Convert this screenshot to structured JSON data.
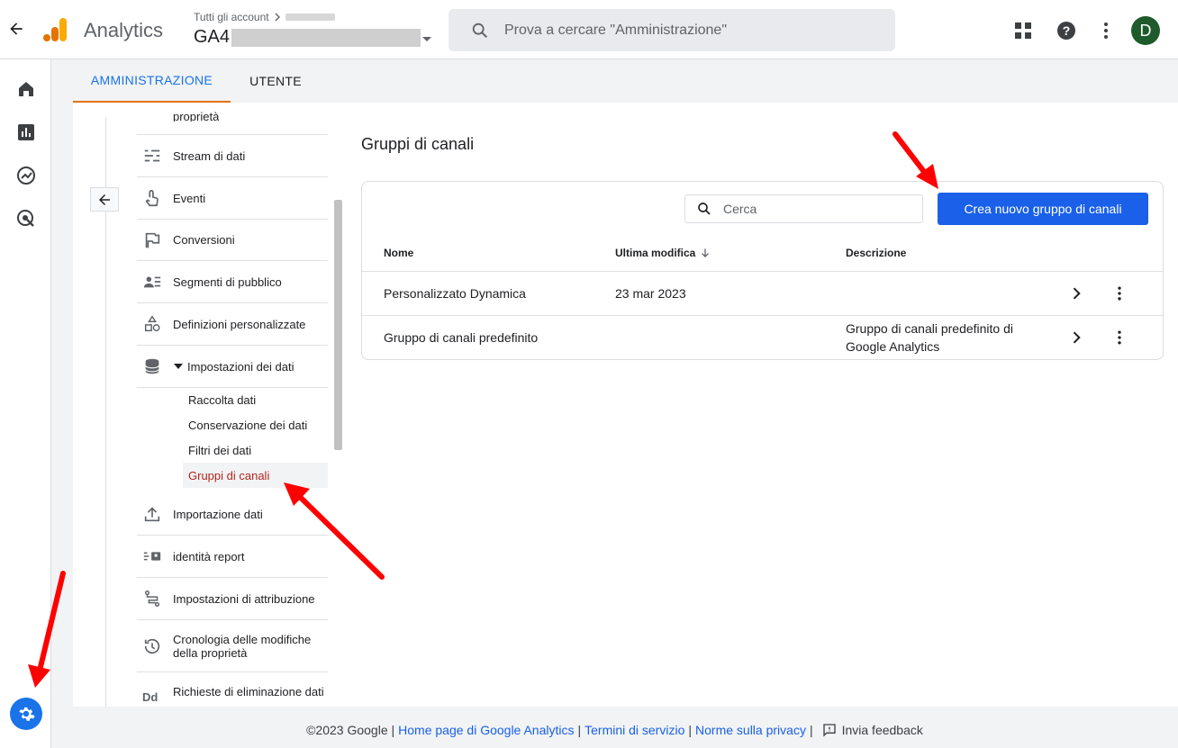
{
  "header": {
    "app_title": "Analytics",
    "breadcrumb": "Tutti gli account",
    "property_name": "GA4",
    "search_placeholder": "Prova a cercare \"Amministrazione\"",
    "avatar_initial": "D"
  },
  "tabs": [
    {
      "label": "AMMINISTRAZIONE",
      "active": true
    },
    {
      "label": "UTENTE",
      "active": false
    }
  ],
  "settings_nav": {
    "partial_label": "proprietà",
    "items": [
      {
        "label": "Stream di dati",
        "icon": "stream-icon"
      },
      {
        "label": "Eventi",
        "icon": "touch-icon"
      },
      {
        "label": "Conversioni",
        "icon": "flag-icon"
      },
      {
        "label": "Segmenti di pubblico",
        "icon": "audience-icon"
      },
      {
        "label": "Definizioni personalizzate",
        "icon": "shapes-icon"
      },
      {
        "label": "Impostazioni dei dati",
        "icon": "database-icon"
      }
    ],
    "sub_items": [
      {
        "label": "Raccolta dati"
      },
      {
        "label": "Conservazione dei dati"
      },
      {
        "label": "Filtri dei dati"
      },
      {
        "label": "Gruppi di canali",
        "active": true
      }
    ],
    "items_after": [
      {
        "label": "Importazione dati",
        "icon": "upload-icon"
      },
      {
        "label": "identità report",
        "icon": "identity-icon"
      },
      {
        "label": "Impostazioni di attribuzione",
        "icon": "attribution-icon"
      },
      {
        "label": "Cronologia delle modifiche della proprietà",
        "icon": "history-icon"
      },
      {
        "label": "Richieste di eliminazione dati",
        "icon": "dd-icon"
      }
    ]
  },
  "main": {
    "title": "Gruppi di canali",
    "search_placeholder": "Cerca",
    "create_button": "Crea nuovo gruppo di canali",
    "columns": {
      "name": "Nome",
      "modified": "Ultima modifica",
      "description": "Descrizione"
    },
    "rows": [
      {
        "name": "Personalizzato Dynamica",
        "modified": "23 mar 2023",
        "description": ""
      },
      {
        "name": "Gruppo di canali predefinito",
        "modified": "",
        "description": "Gruppo di canali predefinito di Google Analytics"
      }
    ]
  },
  "footer": {
    "copyright": "©2023 Google |",
    "link_home": "Home page di Google Analytics",
    "sep1": "|",
    "link_terms": "Termini di servizio",
    "sep2": "|",
    "link_privacy": "Norme sulla privacy",
    "sep3": "|",
    "feedback": "Invia feedback"
  },
  "colors": {
    "accent": "#1a73e8",
    "button": "#1a60e8",
    "tab_underline": "#e8710a",
    "active_sub_item": "#b3261e",
    "annotation_arrow": "#ff0000"
  }
}
